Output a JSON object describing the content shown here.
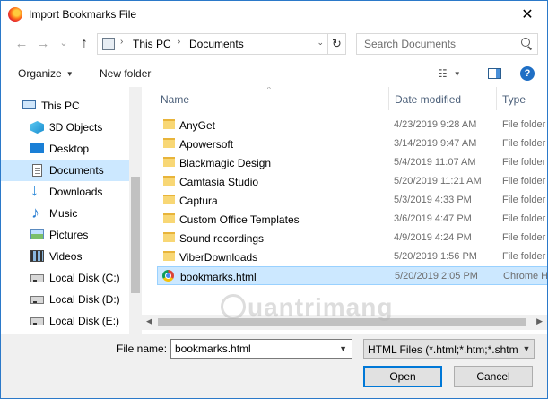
{
  "window": {
    "title": "Import Bookmarks File",
    "close_glyph": "✕"
  },
  "nav": {
    "back_glyph": "←",
    "forward_glyph": "→",
    "recent_glyph": "⌄",
    "up_glyph": "↑",
    "breadcrumb": [
      "This PC",
      "Documents"
    ],
    "refresh_glyph": "↻"
  },
  "search": {
    "placeholder": "Search Documents"
  },
  "toolbar": {
    "organize_label": "Organize",
    "new_folder_label": "New folder",
    "help_glyph": "?",
    "view_glyph": "☷"
  },
  "navpane": {
    "items": [
      {
        "label": "This PC",
        "icon": "pc-icon"
      },
      {
        "label": "3D Objects",
        "icon": "3d-objects-icon"
      },
      {
        "label": "Desktop",
        "icon": "desktop-icon"
      },
      {
        "label": "Documents",
        "icon": "documents-icon",
        "selected": true
      },
      {
        "label": "Downloads",
        "icon": "downloads-icon"
      },
      {
        "label": "Music",
        "icon": "music-icon"
      },
      {
        "label": "Pictures",
        "icon": "pictures-icon"
      },
      {
        "label": "Videos",
        "icon": "videos-icon"
      },
      {
        "label": "Local Disk (C:)",
        "icon": "disk-icon"
      },
      {
        "label": "Local Disk (D:)",
        "icon": "disk-icon"
      },
      {
        "label": "Local Disk (E:)",
        "icon": "disk-icon"
      }
    ]
  },
  "filelist": {
    "columns": {
      "name": "Name",
      "date": "Date modified",
      "type": "Type"
    },
    "rows": [
      {
        "name": "AnyGet",
        "date": "4/23/2019 9:28 AM",
        "type": "File folder",
        "kind": "folder"
      },
      {
        "name": "Apowersoft",
        "date": "3/14/2019 9:47 AM",
        "type": "File folder",
        "kind": "folder"
      },
      {
        "name": "Blackmagic Design",
        "date": "5/4/2019 11:07 AM",
        "type": "File folder",
        "kind": "folder"
      },
      {
        "name": "Camtasia Studio",
        "date": "5/20/2019 11:21 AM",
        "type": "File folder",
        "kind": "folder"
      },
      {
        "name": "Captura",
        "date": "5/3/2019 4:33 PM",
        "type": "File folder",
        "kind": "folder"
      },
      {
        "name": "Custom Office Templates",
        "date": "3/6/2019 4:47 PM",
        "type": "File folder",
        "kind": "folder"
      },
      {
        "name": "Sound recordings",
        "date": "4/9/2019 4:24 PM",
        "type": "File folder",
        "kind": "folder"
      },
      {
        "name": "ViberDownloads",
        "date": "5/20/2019 1:56 PM",
        "type": "File folder",
        "kind": "folder"
      },
      {
        "name": "bookmarks.html",
        "date": "5/20/2019 2:05 PM",
        "type": "Chrome H",
        "kind": "html",
        "selected": true
      }
    ]
  },
  "watermark": "uantrimang",
  "footer": {
    "filename_label": "File name:",
    "filename_value": "bookmarks.html",
    "filetype_value": "HTML Files (*.html;*.htm;*.shtm",
    "open_label": "Open",
    "cancel_label": "Cancel"
  }
}
